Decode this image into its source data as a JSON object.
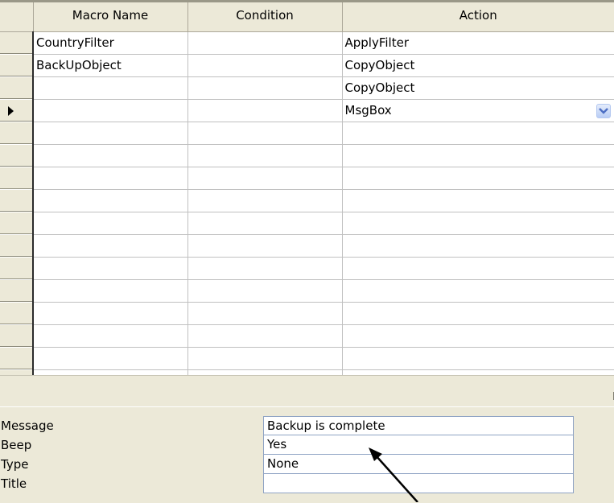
{
  "grid": {
    "columns": [
      "Macro Name",
      "Condition",
      "Action"
    ],
    "rows": [
      {
        "macro_name": "CountryFilter",
        "condition": "",
        "action": "ApplyFilter"
      },
      {
        "macro_name": "BackUpObject",
        "condition": "",
        "action": "CopyObject"
      },
      {
        "macro_name": "",
        "condition": "",
        "action": "CopyObject"
      },
      {
        "macro_name": "",
        "condition": "",
        "action": "MsgBox",
        "current": true
      },
      {
        "macro_name": "",
        "condition": "",
        "action": ""
      },
      {
        "macro_name": "",
        "condition": "",
        "action": ""
      },
      {
        "macro_name": "",
        "condition": "",
        "action": ""
      },
      {
        "macro_name": "",
        "condition": "",
        "action": ""
      },
      {
        "macro_name": "",
        "condition": "",
        "action": ""
      },
      {
        "macro_name": "",
        "condition": "",
        "action": ""
      },
      {
        "macro_name": "",
        "condition": "",
        "action": ""
      },
      {
        "macro_name": "",
        "condition": "",
        "action": ""
      },
      {
        "macro_name": "",
        "condition": "",
        "action": ""
      },
      {
        "macro_name": "",
        "condition": "",
        "action": ""
      },
      {
        "macro_name": "",
        "condition": "",
        "action": ""
      },
      {
        "macro_name": "",
        "condition": "",
        "action": ""
      }
    ],
    "current_row_icon": "row-pointer-icon",
    "combo_icon": "chevron-down-icon"
  },
  "arguments": [
    {
      "label": "Message",
      "value": "Backup is complete"
    },
    {
      "label": "Beep",
      "value": "Yes"
    },
    {
      "label": "Type",
      "value": "None"
    },
    {
      "label": "Title",
      "value": ""
    }
  ],
  "colors": {
    "chrome": "#ece9d8",
    "grid_background": "#ffffff",
    "grid_line": "#c0c0c0",
    "combo_accent": "#4d6fc4",
    "argument_border": "#8fa3c4",
    "annotation_arrow": "#000000"
  }
}
